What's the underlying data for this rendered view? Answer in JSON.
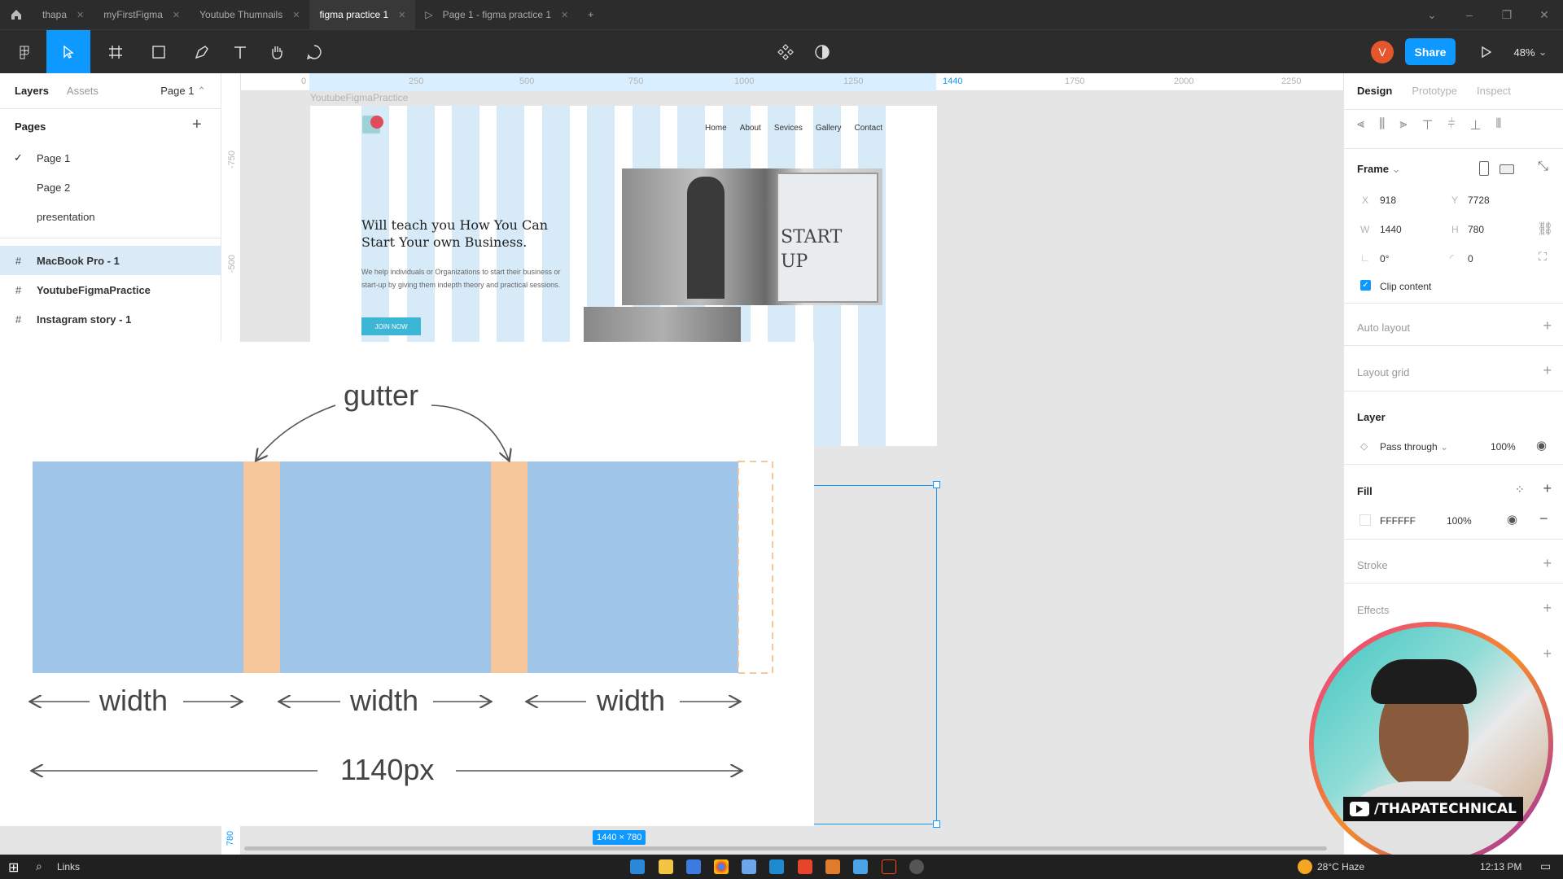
{
  "tabs": [
    {
      "label": "thapa"
    },
    {
      "label": "myFirstFigma"
    },
    {
      "label": "Youtube Thumnails"
    },
    {
      "label": "figma practice 1",
      "active": true
    },
    {
      "label": "Page 1 - figma practice 1",
      "prefix": "▷"
    }
  ],
  "toolbar": {
    "share_label": "Share",
    "zoom": "48%",
    "avatar_initial": "V"
  },
  "left_panel": {
    "tabs": {
      "layers": "Layers",
      "assets": "Assets"
    },
    "page_selector": "Page 1",
    "pages_heading": "Pages",
    "pages": [
      "Page 1",
      "Page 2",
      "presentation"
    ],
    "layers": [
      "MacBook Pro - 1",
      "YoutubeFigmaPractice",
      "Instagram story - 1"
    ]
  },
  "rulers": {
    "top": [
      "0",
      "250",
      "500",
      "750",
      "1000",
      "1250",
      "1440",
      "1750",
      "2000",
      "2250"
    ],
    "left": [
      "-750",
      "-500",
      "780"
    ]
  },
  "frame": {
    "name": "YoutubeFigmaPractice",
    "nav": [
      "Home",
      "About",
      "Sevices",
      "Gallery",
      "Contact"
    ],
    "heading": "Will teach you How You Can Start Your own Business.",
    "body": "We help individuals or Organizations to start their business or start-up by giving them indepth theory and practical sessions.",
    "button": "JOIN NOW",
    "size_badge": "1440 × 780",
    "image_text": "START UP"
  },
  "diagram": {
    "gutter_label": "gutter",
    "width_label": "width",
    "total_label": "1140px",
    "colors": {
      "column": "#9fc5e8",
      "gutter": "#f6c79b"
    }
  },
  "right_panel": {
    "tabs": {
      "design": "Design",
      "prototype": "Prototype",
      "inspect": "Inspect"
    },
    "frame_heading": "Frame",
    "x_label": "X",
    "x": "918",
    "y_label": "Y",
    "y": "7728",
    "w_label": "W",
    "w": "1440",
    "h_label": "H",
    "h": "780",
    "rotation": "0°",
    "radius": "0",
    "clip_content": "Clip content",
    "auto_layout": "Auto layout",
    "layout_grid": "Layout grid",
    "layer_heading": "Layer",
    "blend_mode": "Pass through",
    "layer_opacity": "100%",
    "fill_heading": "Fill",
    "fill_hex": "FFFFFF",
    "fill_opacity": "100%",
    "stroke": "Stroke",
    "effects": "Effects"
  },
  "webcam": {
    "channel": "/THAPATECHNICAL"
  },
  "taskbar": {
    "search_label": "Links",
    "weather": "28°C Haze",
    "time": "12:13 PM"
  },
  "accent": "#0d99ff"
}
